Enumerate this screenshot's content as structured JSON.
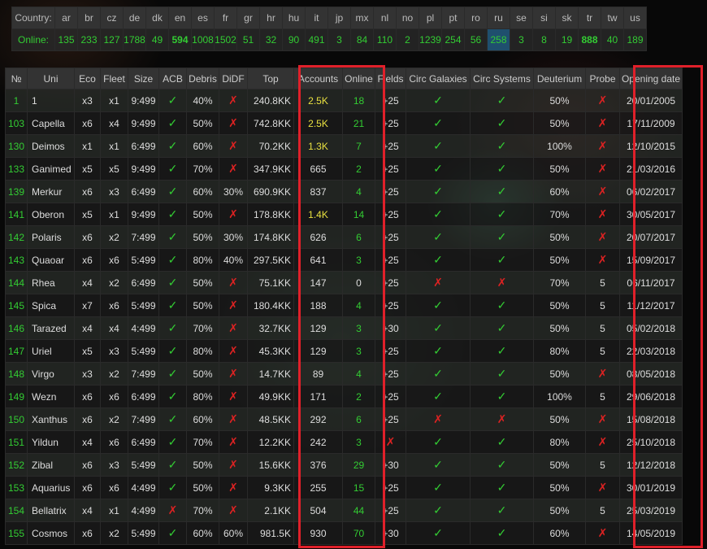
{
  "country_bar": {
    "label_country": "Country:",
    "label_online": "Online:",
    "countries": [
      {
        "code": "ar",
        "online": "135",
        "style": ""
      },
      {
        "code": "br",
        "online": "233",
        "style": ""
      },
      {
        "code": "cz",
        "online": "127",
        "style": ""
      },
      {
        "code": "de",
        "online": "1788",
        "style": "red"
      },
      {
        "code": "dk",
        "online": "49",
        "style": ""
      },
      {
        "code": "en",
        "online": "594",
        "style": "yellow"
      },
      {
        "code": "es",
        "online": "1008",
        "style": "red"
      },
      {
        "code": "fr",
        "online": "1502",
        "style": "red"
      },
      {
        "code": "gr",
        "online": "51",
        "style": ""
      },
      {
        "code": "hr",
        "online": "32",
        "style": ""
      },
      {
        "code": "hu",
        "online": "90",
        "style": ""
      },
      {
        "code": "it",
        "online": "491",
        "style": ""
      },
      {
        "code": "jp",
        "online": "3",
        "style": ""
      },
      {
        "code": "mx",
        "online": "84",
        "style": ""
      },
      {
        "code": "nl",
        "online": "110",
        "style": ""
      },
      {
        "code": "no",
        "online": "2",
        "style": ""
      },
      {
        "code": "pl",
        "online": "1239",
        "style": "red"
      },
      {
        "code": "pt",
        "online": "254",
        "style": ""
      },
      {
        "code": "ro",
        "online": "56",
        "style": ""
      },
      {
        "code": "ru",
        "online": "258",
        "style": "blue"
      },
      {
        "code": "se",
        "online": "3",
        "style": ""
      },
      {
        "code": "si",
        "online": "8",
        "style": ""
      },
      {
        "code": "sk",
        "online": "19",
        "style": ""
      },
      {
        "code": "tr",
        "online": "888",
        "style": "yellow"
      },
      {
        "code": "tw",
        "online": "40",
        "style": ""
      },
      {
        "code": "us",
        "online": "189",
        "style": ""
      }
    ]
  },
  "table": {
    "headers": [
      "№",
      "Uni",
      "Eco",
      "Fleet",
      "Size",
      "ACB",
      "Debris",
      "DiDF",
      "Top",
      "Accounts",
      "Online",
      "Fields",
      "Circ Galaxies",
      "Circ Systems",
      "Deuterium",
      "Probe",
      "Opening date"
    ],
    "rows": [
      {
        "no": "1",
        "uni": "1",
        "eco": "x3",
        "fleet": "x1",
        "size": "9:499",
        "acb": "check",
        "debris": "40%",
        "didf": "cross",
        "top": "240.8KK",
        "top_y": false,
        "accounts": "2.5K",
        "acc_y": true,
        "online": "18",
        "online_g": true,
        "fields": "+25",
        "cg": "check",
        "cs": "check",
        "deut": "50%",
        "probe": "cross",
        "date": "20/01/2005"
      },
      {
        "no": "103",
        "uni": "Capella",
        "eco": "x6",
        "fleet": "x4",
        "size": "9:499",
        "acb": "check",
        "debris": "50%",
        "didf": "cross",
        "top": "742.8KK",
        "top_y": false,
        "accounts": "2.5K",
        "acc_y": true,
        "online": "21",
        "online_g": true,
        "fields": "+25",
        "cg": "check",
        "cs": "check",
        "deut": "50%",
        "probe": "cross",
        "date": "17/11/2009"
      },
      {
        "no": "130",
        "uni": "Deimos",
        "eco": "x1",
        "fleet": "x1",
        "size": "6:499",
        "acb": "check",
        "debris": "60%",
        "didf": "cross",
        "top": "70.2KK",
        "top_y": false,
        "accounts": "1.3K",
        "acc_y": true,
        "online": "7",
        "online_g": true,
        "fields": "+25",
        "cg": "check",
        "cs": "check",
        "deut": "100%",
        "probe": "cross",
        "date": "12/10/2015"
      },
      {
        "no": "133",
        "uni": "Ganimed",
        "eco": "x5",
        "fleet": "x5",
        "size": "9:499",
        "acb": "check",
        "debris": "70%",
        "didf": "cross",
        "top": "347.9KK",
        "top_y": false,
        "accounts": "665",
        "acc_y": false,
        "online": "2",
        "online_g": true,
        "fields": "+25",
        "cg": "check",
        "cs": "check",
        "deut": "50%",
        "probe": "cross",
        "date": "21/03/2016"
      },
      {
        "no": "139",
        "uni": "Merkur",
        "eco": "x6",
        "fleet": "x3",
        "size": "6:499",
        "acb": "check",
        "debris": "60%",
        "didf": "30%",
        "top": "690.9KK",
        "top_y": false,
        "accounts": "837",
        "acc_y": false,
        "online": "4",
        "online_g": true,
        "fields": "+25",
        "cg": "check",
        "cs": "check",
        "deut": "60%",
        "probe": "cross",
        "date": "06/02/2017"
      },
      {
        "no": "141",
        "uni": "Oberon",
        "eco": "x5",
        "fleet": "x1",
        "size": "9:499",
        "acb": "check",
        "debris": "50%",
        "didf": "cross",
        "top": "178.8KK",
        "top_y": false,
        "accounts": "1.4K",
        "acc_y": true,
        "online": "14",
        "online_g": true,
        "fields": "+25",
        "cg": "check",
        "cs": "check",
        "deut": "70%",
        "probe": "cross",
        "date": "30/05/2017"
      },
      {
        "no": "142",
        "uni": "Polaris",
        "eco": "x6",
        "fleet": "x2",
        "size": "7:499",
        "acb": "check",
        "debris": "50%",
        "didf": "30%",
        "top": "174.8KK",
        "top_y": false,
        "accounts": "626",
        "acc_y": false,
        "online": "6",
        "online_g": true,
        "fields": "+25",
        "cg": "check",
        "cs": "check",
        "deut": "50%",
        "probe": "cross",
        "date": "20/07/2017"
      },
      {
        "no": "143",
        "uni": "Quaoar",
        "eco": "x6",
        "fleet": "x6",
        "size": "5:499",
        "acb": "check",
        "debris": "80%",
        "didf": "40%",
        "top": "297.5KK",
        "top_y": false,
        "accounts": "641",
        "acc_y": false,
        "online": "3",
        "online_g": true,
        "fields": "+25",
        "cg": "check",
        "cs": "check",
        "deut": "50%",
        "probe": "cross",
        "date": "15/09/2017"
      },
      {
        "no": "144",
        "uni": "Rhea",
        "eco": "x4",
        "fleet": "x2",
        "size": "6:499",
        "acb": "check",
        "debris": "50%",
        "didf": "cross",
        "top": "75.1KK",
        "top_y": false,
        "accounts": "147",
        "acc_y": false,
        "online": "0",
        "online_g": false,
        "fields": "+25",
        "cg": "cross",
        "cs": "cross",
        "deut": "70%",
        "probe": "5",
        "date": "06/11/2017"
      },
      {
        "no": "145",
        "uni": "Spica",
        "eco": "x7",
        "fleet": "x6",
        "size": "5:499",
        "acb": "check",
        "debris": "50%",
        "didf": "cross",
        "top": "180.4KK",
        "top_y": false,
        "accounts": "188",
        "acc_y": false,
        "online": "4",
        "online_g": true,
        "fields": "+25",
        "cg": "check",
        "cs": "check",
        "deut": "50%",
        "probe": "5",
        "date": "11/12/2017"
      },
      {
        "no": "146",
        "uni": "Tarazed",
        "eco": "x4",
        "fleet": "x4",
        "size": "4:499",
        "acb": "check",
        "debris": "70%",
        "didf": "cross",
        "top": "32.7KK",
        "top_y": false,
        "accounts": "129",
        "acc_y": false,
        "online": "3",
        "online_g": true,
        "fields": "+30",
        "cg": "check",
        "cs": "check",
        "deut": "50%",
        "probe": "5",
        "date": "05/02/2018"
      },
      {
        "no": "147",
        "uni": "Uriel",
        "eco": "x5",
        "fleet": "x3",
        "size": "5:499",
        "acb": "check",
        "debris": "80%",
        "didf": "cross",
        "top": "45.3KK",
        "top_y": false,
        "accounts": "129",
        "acc_y": false,
        "online": "3",
        "online_g": true,
        "fields": "+25",
        "cg": "check",
        "cs": "check",
        "deut": "80%",
        "probe": "5",
        "date": "22/03/2018"
      },
      {
        "no": "148",
        "uni": "Virgo",
        "eco": "x3",
        "fleet": "x2",
        "size": "7:499",
        "acb": "check",
        "debris": "50%",
        "didf": "cross",
        "top": "14.7KK",
        "top_y": false,
        "accounts": "89",
        "acc_y": false,
        "online": "4",
        "online_g": true,
        "fields": "+25",
        "cg": "check",
        "cs": "check",
        "deut": "50%",
        "probe": "cross",
        "date": "08/05/2018"
      },
      {
        "no": "149",
        "uni": "Wezn",
        "eco": "x6",
        "fleet": "x6",
        "size": "6:499",
        "acb": "check",
        "debris": "80%",
        "didf": "cross",
        "top": "49.9KK",
        "top_y": false,
        "accounts": "171",
        "acc_y": false,
        "online": "2",
        "online_g": true,
        "fields": "+25",
        "cg": "check",
        "cs": "check",
        "deut": "100%",
        "probe": "5",
        "date": "29/06/2018"
      },
      {
        "no": "150",
        "uni": "Xanthus",
        "eco": "x6",
        "fleet": "x2",
        "size": "7:499",
        "acb": "check",
        "debris": "60%",
        "didf": "cross",
        "top": "48.5KK",
        "top_y": false,
        "accounts": "292",
        "acc_y": false,
        "online": "6",
        "online_g": true,
        "fields": "+25",
        "cg": "cross",
        "cs": "cross",
        "deut": "50%",
        "probe": "cross",
        "date": "15/08/2018"
      },
      {
        "no": "151",
        "uni": "Yildun",
        "eco": "x4",
        "fleet": "x6",
        "size": "6:499",
        "acb": "check",
        "debris": "70%",
        "didf": "cross",
        "top": "12.2KK",
        "top_y": false,
        "accounts": "242",
        "acc_y": false,
        "online": "3",
        "online_g": true,
        "fields": "cross",
        "cg": "check",
        "cs": "check",
        "deut": "80%",
        "probe": "cross",
        "date": "25/10/2018"
      },
      {
        "no": "152",
        "uni": "Zibal",
        "eco": "x6",
        "fleet": "x3",
        "size": "5:499",
        "acb": "check",
        "debris": "50%",
        "didf": "cross",
        "top": "15.6KK",
        "top_y": false,
        "accounts": "376",
        "acc_y": false,
        "online": "29",
        "online_g": true,
        "fields": "+30",
        "cg": "check",
        "cs": "check",
        "deut": "50%",
        "probe": "5",
        "date": "12/12/2018"
      },
      {
        "no": "153",
        "uni": "Aquarius",
        "eco": "x6",
        "fleet": "x6",
        "size": "4:499",
        "acb": "check",
        "debris": "50%",
        "didf": "cross",
        "top": "9.3KK",
        "top_y": false,
        "accounts": "255",
        "acc_y": false,
        "online": "15",
        "online_g": true,
        "fields": "+25",
        "cg": "check",
        "cs": "check",
        "deut": "50%",
        "probe": "cross",
        "date": "30/01/2019"
      },
      {
        "no": "154",
        "uni": "Bellatrix",
        "eco": "x4",
        "fleet": "x1",
        "size": "4:499",
        "acb": "cross",
        "debris": "70%",
        "didf": "cross",
        "top": "2.1KK",
        "top_y": false,
        "accounts": "504",
        "acc_y": false,
        "online": "44",
        "online_g": true,
        "fields": "+25",
        "cg": "check",
        "cs": "check",
        "deut": "50%",
        "probe": "5",
        "date": "25/03/2019"
      },
      {
        "no": "155",
        "uni": "Cosmos",
        "eco": "x6",
        "fleet": "x2",
        "size": "5:499",
        "acb": "check",
        "debris": "60%",
        "didf": "60%",
        "top": "981.5K",
        "top_y": true,
        "accounts": "930",
        "acc_y": false,
        "online": "70",
        "online_g": true,
        "fields": "+30",
        "cg": "check",
        "cs": "check",
        "deut": "60%",
        "probe": "cross",
        "date": "14/05/2019"
      }
    ]
  },
  "symbols": {
    "check": "✓",
    "cross": "✗"
  },
  "colors": {
    "highlight_box": "#e0202a",
    "green": "#33cc33",
    "yellow": "#e8e040",
    "red": "#dd2222"
  }
}
